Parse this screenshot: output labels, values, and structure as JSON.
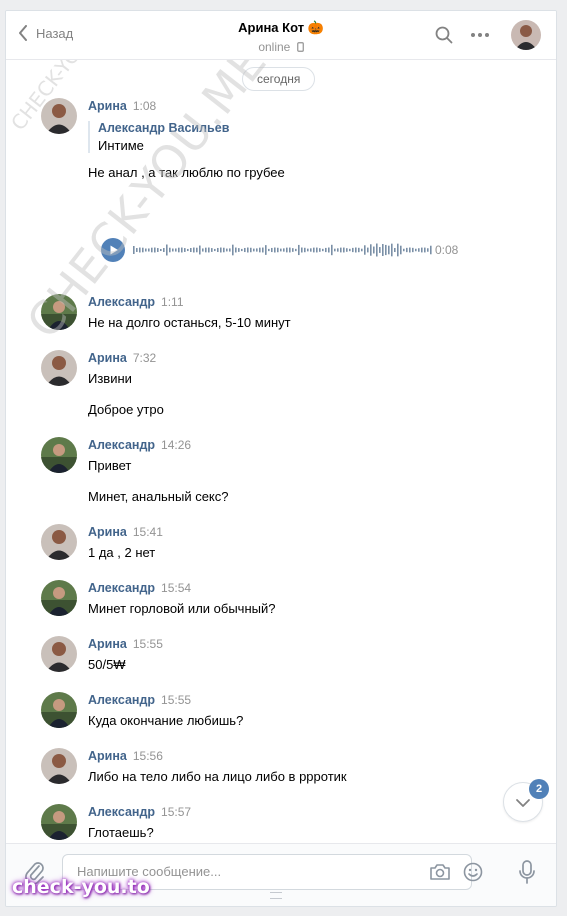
{
  "header": {
    "back_label": "Назад",
    "title": "Арина Кот 🎃",
    "status": "online"
  },
  "date_separator": "сегодня",
  "watermark": "CHECK-YOU.ME",
  "messages": [
    {
      "author": "Арина",
      "time": "1:08",
      "reply": {
        "name": "Александр Васильев",
        "text": "Интиме"
      },
      "lines": [
        "Не анал , а так люблю по грубее"
      ]
    },
    {
      "voice_duration": "0:08"
    },
    {
      "author": "Александр",
      "time": "1:11",
      "lines": [
        "Не на долго останься, 5-10 минут"
      ]
    },
    {
      "author": "Арина",
      "time": "7:32",
      "lines": [
        "Извини",
        "Доброе утро"
      ]
    },
    {
      "author": "Александр",
      "time": "14:26",
      "lines": [
        "Привет",
        "Минет, анальный секс?"
      ]
    },
    {
      "author": "Арина",
      "time": "15:41",
      "lines": [
        "1 да , 2 нет"
      ]
    },
    {
      "author": "Александр",
      "time": "15:54",
      "lines": [
        "Минет горловой или обычный?"
      ]
    },
    {
      "author": "Арина",
      "time": "15:55",
      "lines": [
        "50/5₩"
      ]
    },
    {
      "author": "Александр",
      "time": "15:55",
      "lines": [
        "Куда окончание любишь?"
      ]
    },
    {
      "author": "Арина",
      "time": "15:56",
      "lines": [
        "Либо на тело либо на лицо либо в рр­ротик"
      ]
    },
    {
      "author": "Александр",
      "time": "15:57",
      "lines": [
        "Глотаешь?"
      ]
    }
  ],
  "scroll_down": {
    "unread_count": "2"
  },
  "composer": {
    "placeholder": "Напишите сообщение..."
  },
  "footer_watermark": "check-you.to",
  "colors": {
    "accent": "#5181b8",
    "author": "#42648b",
    "meta": "#939393",
    "page_bg": "#edeef0"
  },
  "icons": [
    "back-chevron-icon",
    "phone-icon",
    "search-icon",
    "more-icon",
    "paperclip-icon",
    "camera-icon",
    "emoji-icon",
    "microphone-icon",
    "play-icon",
    "chevron-down-icon"
  ]
}
